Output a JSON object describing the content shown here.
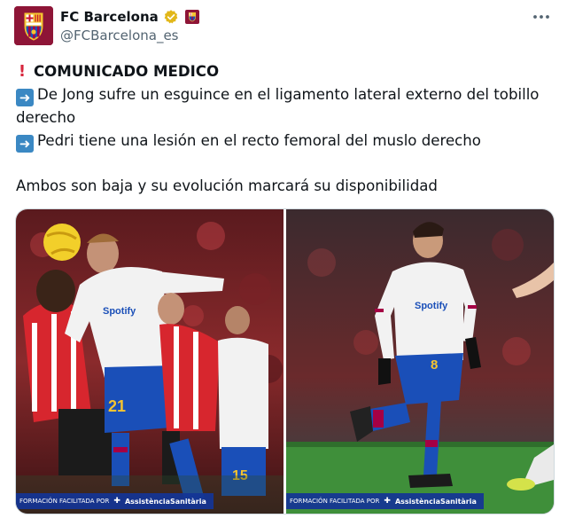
{
  "author": {
    "name": "FC Barcelona",
    "handle": "@FCBarcelona_es"
  },
  "tweet": {
    "heading_icon": "exclamation-icon",
    "heading": "COMUNICADO MEDICO",
    "line1": "De Jong sufre un esguince en el ligamento lateral externo del tobillo derecho",
    "line2": "Pedri tiene una lesión en el recto femoral del muslo derecho",
    "line3": "Ambos son baja y su evolución marcará su disponibilidad",
    "bullet_icon": "right-arrow-icon"
  },
  "media": {
    "photo1": {
      "kit_sponsor": "Spotify",
      "jersey_number": "21",
      "jersey_number_2": "15",
      "credit_prefix": "FORMACIÓN FACILITADA POR",
      "credit_brand": "AssistènciaSanitària"
    },
    "photo2": {
      "kit_sponsor": "Spotify",
      "jersey_number": "8",
      "credit_prefix": "FORMACIÓN FACILITADA POR",
      "credit_brand": "AssistènciaSanitària"
    }
  },
  "colors": {
    "barca_blue": "#1a4fb8",
    "barca_red": "#a50044",
    "link_blue": "#1d9bf0",
    "text_secondary": "#536471"
  }
}
